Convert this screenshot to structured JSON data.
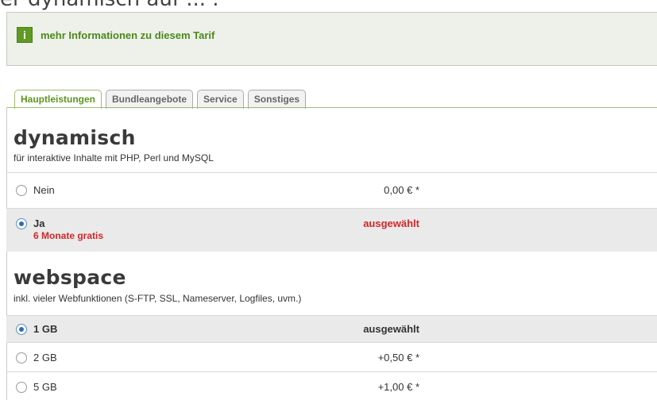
{
  "top_cut_text": "er dynamisch auf ... .",
  "info": {
    "icon": "info-icon",
    "icon_glyph": "i",
    "link_label": "mehr Informationen zu diesem Tarif"
  },
  "tabs": [
    {
      "label": "Hauptleistungen",
      "active": true
    },
    {
      "label": "Bundleangebote",
      "active": false
    },
    {
      "label": "Service",
      "active": false
    },
    {
      "label": "Sonstiges",
      "active": false
    }
  ],
  "sections": {
    "dynamisch": {
      "title": "dynamisch",
      "subtitle": "für interaktive Inhalte mit PHP, Perl und MySQL",
      "options": [
        {
          "label": "Nein",
          "price": "0,00 € *",
          "selected": false
        },
        {
          "label": "Ja",
          "sublabel": "6 Monate gratis",
          "price": "ausgewählt",
          "selected": true
        }
      ]
    },
    "webspace": {
      "title": "webspace",
      "subtitle": "inkl. vieler Webfunktionen (S-FTP, SSL, Nameserver, Logfiles, uvm.)",
      "options": [
        {
          "label": "1 GB",
          "price": "ausgewählt",
          "selected": true
        },
        {
          "label": "2 GB",
          "price": "+0,50 € *",
          "selected": false
        },
        {
          "label": "5 GB",
          "price": "+1,00 € *",
          "selected": false
        }
      ]
    }
  },
  "colors": {
    "accent_green": "#5a961c",
    "selected_red": "#d0282a",
    "radio_blue": "#2f6db3"
  }
}
